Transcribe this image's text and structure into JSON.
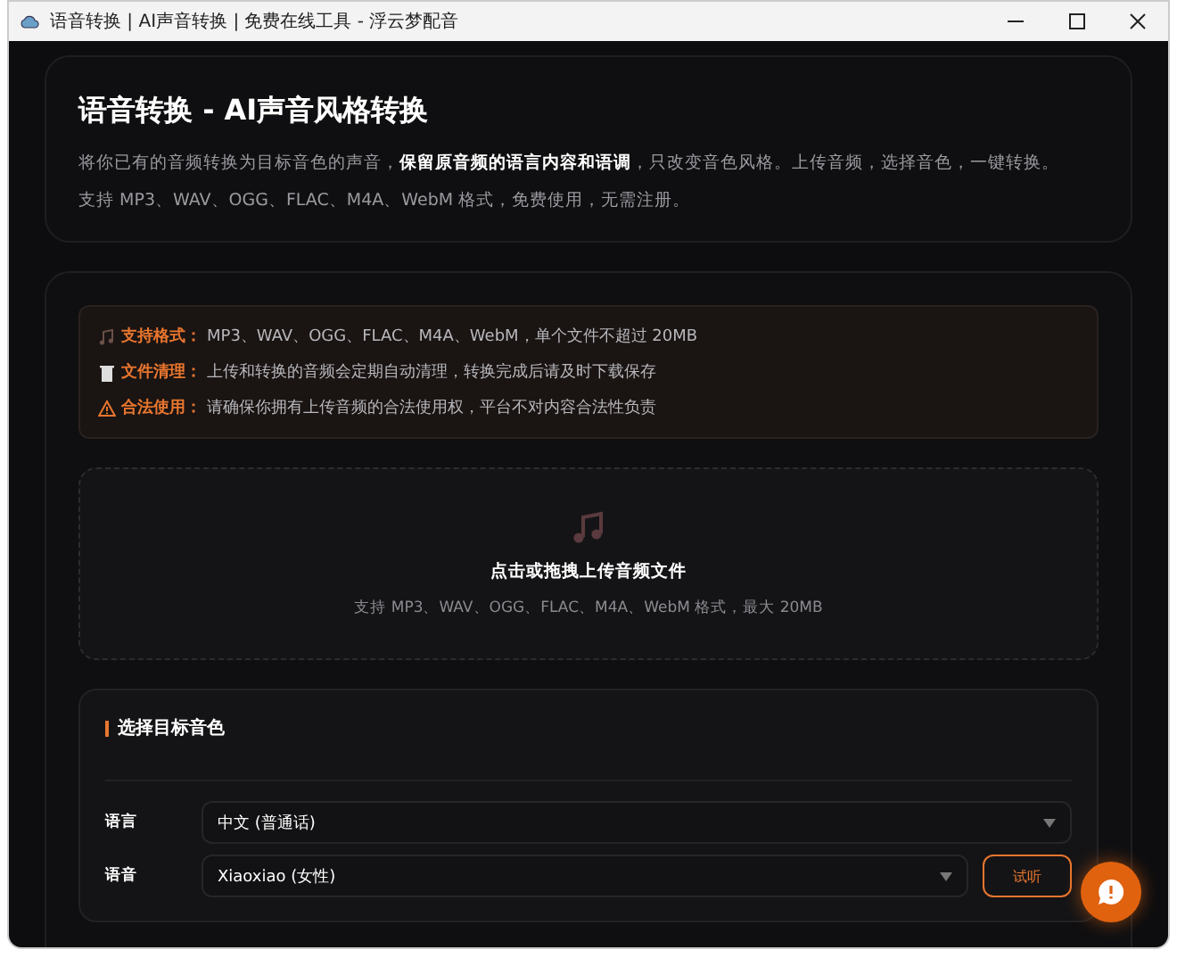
{
  "window": {
    "title": "语音转换 | AI声音转换 | 免费在线工具 - 浮云梦配音"
  },
  "header": {
    "title": "语音转换 - AI声音风格转换",
    "description": "将你已有的音频转换为目标音色的声音，**保留原音频的语言内容和语调**，只改变音色风格。上传音频，选择音色，一键转换。",
    "formats_note": "支持 MP3、WAV、OGG、FLAC、M4A、WebM 格式，免费使用，无需注册。"
  },
  "notices": [
    {
      "kind": "music",
      "label": "支持格式：",
      "text": "MP3、WAV、OGG、FLAC、M4A、WebM，单个文件不超过 20MB"
    },
    {
      "kind": "trash",
      "label": "文件清理：",
      "text": "上传和转换的音频会定期自动清理，转换完成后请及时下载保存"
    },
    {
      "kind": "warning",
      "label": "合法使用：",
      "text": "请确保你拥有上传音频的合法使用权，平台不对内容合法性负责"
    }
  ],
  "upload": {
    "title": "点击或拖拽上传音频文件",
    "hint": "支持 MP3、WAV、OGG、FLAC、M4A、WebM 格式，最大 20MB"
  },
  "voice_panel": {
    "title": "选择目标音色",
    "fields": [
      {
        "label": "语言",
        "value": "中文 (普通话)"
      },
      {
        "label": "语音",
        "value": "Xiaoxiao (女性)",
        "button": "试听"
      }
    ]
  }
}
